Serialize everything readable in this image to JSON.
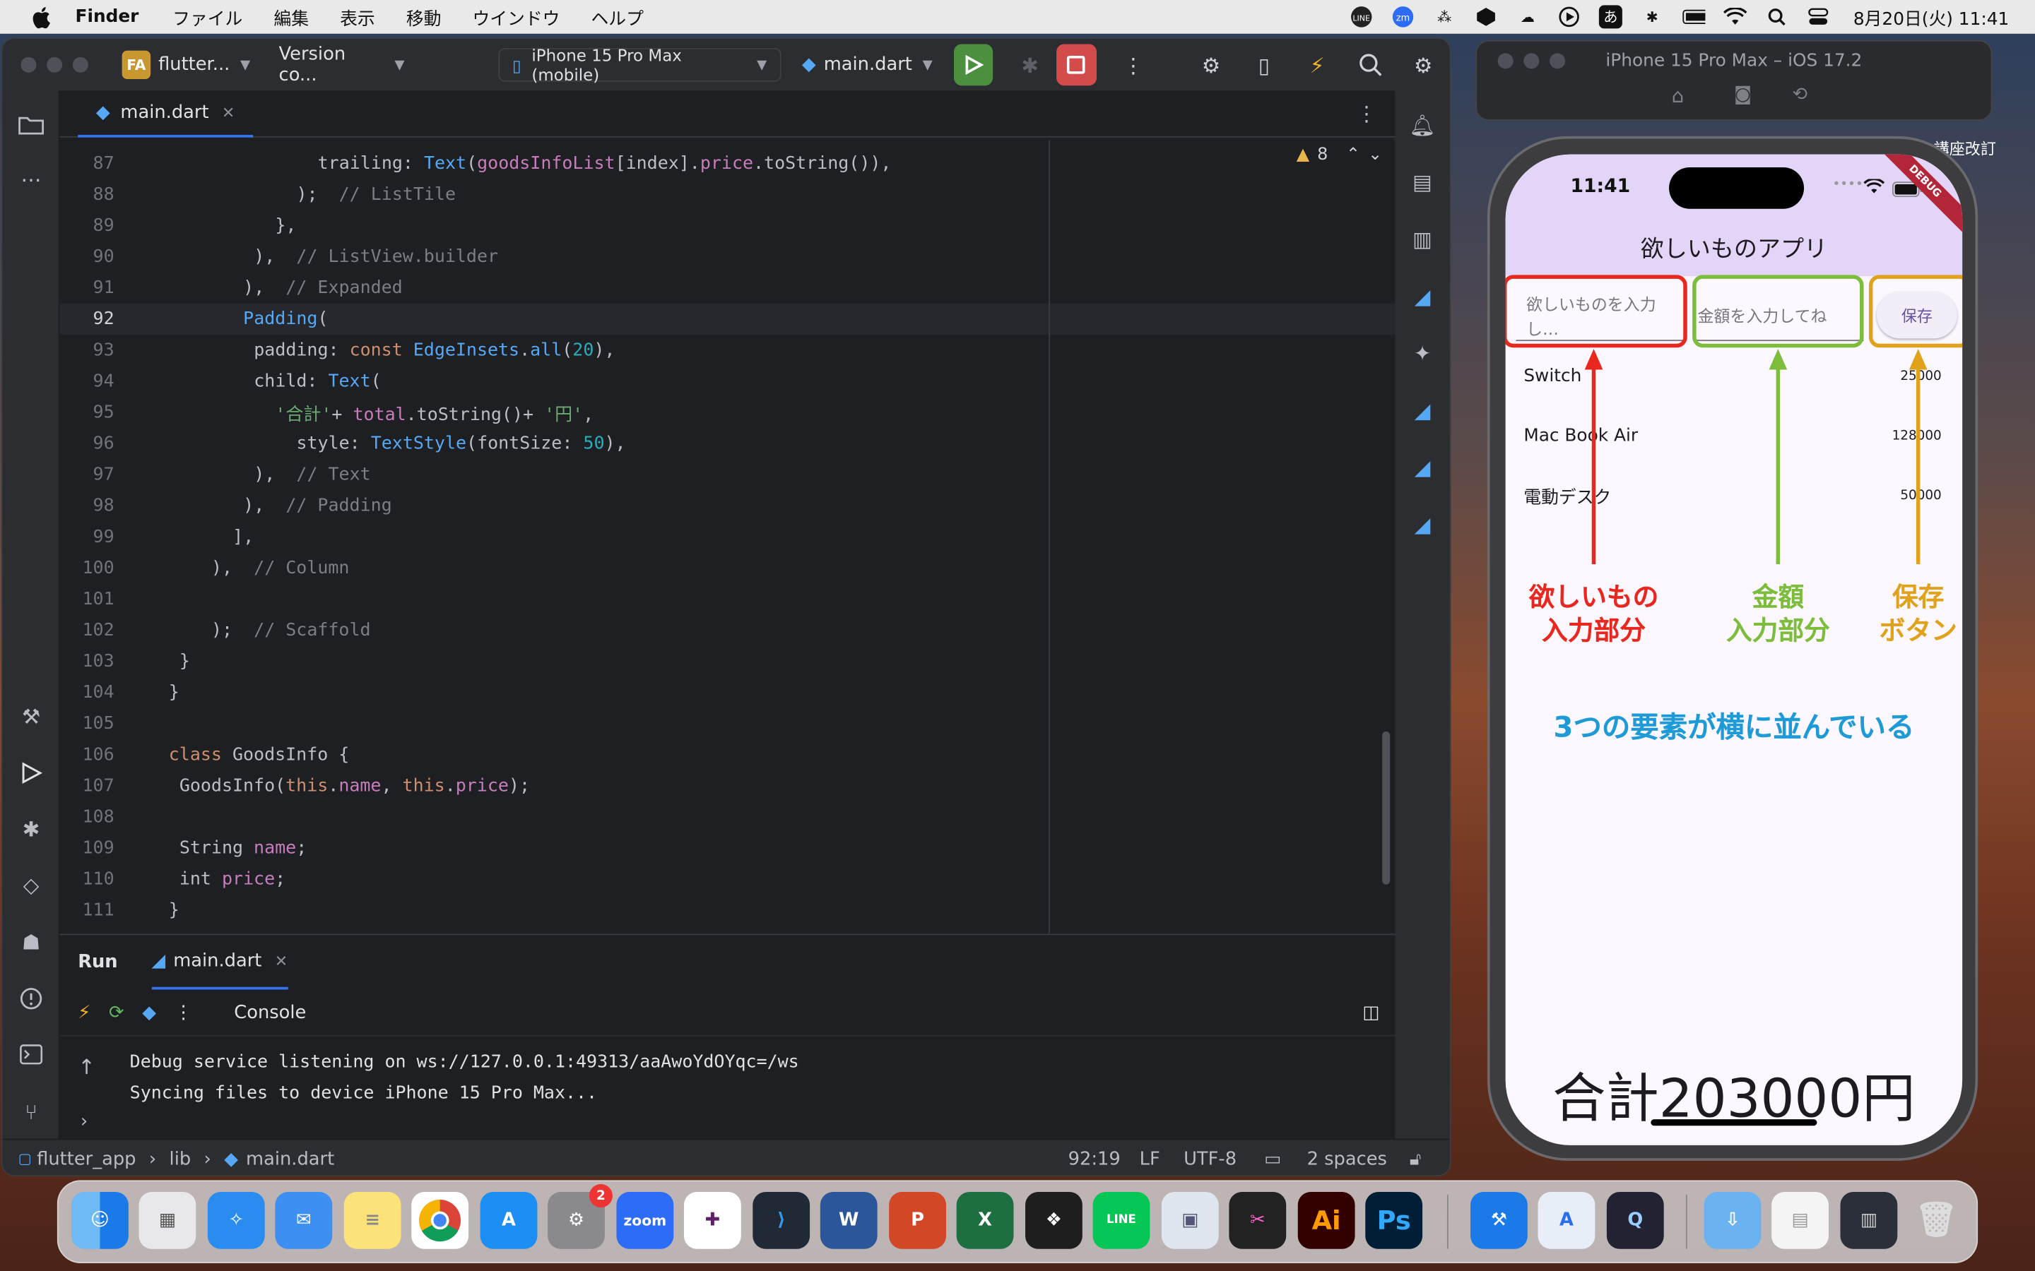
{
  "menubar": {
    "app": "Finder",
    "items": [
      "ファイル",
      "編集",
      "表示",
      "移動",
      "ウインドウ",
      "ヘルプ"
    ],
    "clock": "8月20日(火) 11:41",
    "ime": "あ"
  },
  "ide": {
    "project": "flutter...",
    "project_badge": "FA",
    "vcs": "Version co...",
    "device": "iPhone 15 Pro Max (mobile)",
    "config": "main.dart",
    "tab": "main.dart",
    "warnings": "8",
    "code_lines": [
      {
        "n": "87",
        "indent": 14,
        "segs": [
          [
            "trailing: ",
            "#bcbec4"
          ],
          [
            "Text",
            "#56a8f5"
          ],
          [
            "(",
            "#bcbec4"
          ],
          [
            "goodsInfoList",
            "#c77dbb"
          ],
          [
            "[index].",
            "#bcbec4"
          ],
          [
            "price",
            "#c77dbb"
          ],
          [
            ".toString()),",
            "#bcbec4"
          ]
        ]
      },
      {
        "n": "88",
        "indent": 12,
        "segs": [
          [
            ");  ",
            "#bcbec4"
          ],
          [
            "// ListTile",
            "#7a7e85"
          ]
        ]
      },
      {
        "n": "89",
        "indent": 10,
        "segs": [
          [
            "},",
            "#bcbec4"
          ]
        ]
      },
      {
        "n": "90",
        "indent": 8,
        "segs": [
          [
            "),  ",
            "#bcbec4"
          ],
          [
            "// ListView.builder",
            "#7a7e85"
          ]
        ]
      },
      {
        "n": "91",
        "indent": 7,
        "segs": [
          [
            "),  ",
            "#bcbec4"
          ],
          [
            "// Expanded",
            "#7a7e85"
          ]
        ]
      },
      {
        "n": "92",
        "indent": 7,
        "segs": [
          [
            "Padding",
            "#56a8f5"
          ],
          [
            "(",
            "#bcbec4"
          ]
        ]
      },
      {
        "n": "93",
        "indent": 8,
        "segs": [
          [
            "padding: ",
            "#bcbec4"
          ],
          [
            "const ",
            "#cf8e6d"
          ],
          [
            "EdgeInsets",
            "#56a8f5"
          ],
          [
            ".",
            "#bcbec4"
          ],
          [
            "all",
            "#56a8f5"
          ],
          [
            "(",
            "#bcbec4"
          ],
          [
            "20",
            "#2aacb8"
          ],
          [
            "),",
            "#bcbec4"
          ]
        ]
      },
      {
        "n": "94",
        "indent": 8,
        "segs": [
          [
            "child: ",
            "#bcbec4"
          ],
          [
            "Text",
            "#56a8f5"
          ],
          [
            "(",
            "#bcbec4"
          ]
        ]
      },
      {
        "n": "95",
        "indent": 10,
        "segs": [
          [
            "'合計'",
            "#6aab73"
          ],
          [
            "+ ",
            "#bcbec4"
          ],
          [
            "total",
            "#c77dbb"
          ],
          [
            ".toString()+ ",
            "#bcbec4"
          ],
          [
            "'円'",
            "#6aab73"
          ],
          [
            ",",
            "#bcbec4"
          ]
        ]
      },
      {
        "n": "96",
        "indent": 12,
        "segs": [
          [
            "style: ",
            "#bcbec4"
          ],
          [
            "TextStyle",
            "#56a8f5"
          ],
          [
            "(",
            "#bcbec4"
          ],
          [
            "fontSize: ",
            "#bcbec4"
          ],
          [
            "50",
            "#2aacb8"
          ],
          [
            "),",
            "#bcbec4"
          ]
        ]
      },
      {
        "n": "97",
        "indent": 8,
        "segs": [
          [
            "),  ",
            "#bcbec4"
          ],
          [
            "// Text",
            "#7a7e85"
          ]
        ]
      },
      {
        "n": "98",
        "indent": 7,
        "segs": [
          [
            "),  ",
            "#bcbec4"
          ],
          [
            "// Padding",
            "#7a7e85"
          ]
        ]
      },
      {
        "n": "99",
        "indent": 6,
        "segs": [
          [
            "],",
            "#bcbec4"
          ]
        ]
      },
      {
        "n": "100",
        "indent": 4,
        "segs": [
          [
            "),  ",
            "#bcbec4"
          ],
          [
            "// Column",
            "#7a7e85"
          ]
        ]
      },
      {
        "n": "101",
        "indent": 0,
        "segs": []
      },
      {
        "n": "102",
        "indent": 4,
        "segs": [
          [
            ");  ",
            "#bcbec4"
          ],
          [
            "// Scaffold",
            "#7a7e85"
          ]
        ]
      },
      {
        "n": "103",
        "indent": 1,
        "segs": [
          [
            "}",
            "#bcbec4"
          ]
        ]
      },
      {
        "n": "104",
        "indent": 0,
        "segs": [
          [
            "}",
            "#bcbec4"
          ]
        ]
      },
      {
        "n": "105",
        "indent": 0,
        "segs": []
      },
      {
        "n": "106",
        "indent": 0,
        "segs": [
          [
            "class ",
            "#cf8e6d"
          ],
          [
            "GoodsInfo {",
            "#bcbec4"
          ]
        ]
      },
      {
        "n": "107",
        "indent": 1,
        "segs": [
          [
            "GoodsInfo(",
            "#bcbec4"
          ],
          [
            "this",
            "#cf8e6d"
          ],
          [
            ".",
            "#bcbec4"
          ],
          [
            "name",
            "#c77dbb"
          ],
          [
            ", ",
            "#bcbec4"
          ],
          [
            "this",
            "#cf8e6d"
          ],
          [
            ".",
            "#bcbec4"
          ],
          [
            "price",
            "#c77dbb"
          ],
          [
            ");",
            "#bcbec4"
          ]
        ]
      },
      {
        "n": "108",
        "indent": 0,
        "segs": []
      },
      {
        "n": "109",
        "indent": 1,
        "segs": [
          [
            "String ",
            "#bcbec4"
          ],
          [
            "name",
            "#c77dbb"
          ],
          [
            ";",
            "#bcbec4"
          ]
        ]
      },
      {
        "n": "110",
        "indent": 1,
        "segs": [
          [
            "int ",
            "#bcbec4"
          ],
          [
            "price",
            "#c77dbb"
          ],
          [
            ";",
            "#bcbec4"
          ]
        ]
      },
      {
        "n": "111",
        "indent": 0,
        "segs": [
          [
            "}",
            "#bcbec4"
          ]
        ]
      }
    ],
    "current_line": "92",
    "run": {
      "tab_run": "Run",
      "tab_file": "main.dart",
      "console_label": "Console",
      "lines": [
        "Debug service listening on ws://127.0.0.1:49313/aaAwoYdOYqc=/ws",
        "Syncing files to device iPhone 15 Pro Max..."
      ]
    },
    "status": {
      "crumbs": [
        "flutter_app",
        "lib",
        "main.dart"
      ],
      "position": "92:19",
      "line_sep": "LF",
      "encoding": "UTF-8",
      "indent": "2 spaces"
    }
  },
  "simulator": {
    "title": "iPhone 15 Pro Max – iOS 17.2",
    "side_text": "講座改訂",
    "time": "11:41",
    "debug_banner": "DEBUG",
    "app_title": "欲しいものアプリ",
    "name_placeholder": "欲しいものを入力し…",
    "price_placeholder": "金額を入力してね",
    "save_label": "保存",
    "items": [
      {
        "name": "Switch",
        "price": "25000"
      },
      {
        "name": "Mac Book Air",
        "price": "128000"
      },
      {
        "name": "電動デスク",
        "price": "50000"
      }
    ],
    "total": "合計203000円",
    "annotations": {
      "name_label_1": "欲しいもの",
      "name_label_2": "入力部分",
      "price_label_1": "金額",
      "price_label_2": "入力部分",
      "save_label_1": "保存",
      "save_label_2": "ボタン",
      "summary": "3つの要素が横に並んでいる"
    },
    "colors": {
      "red": "#e8281e",
      "green": "#7cbd3c",
      "yellow": "#e0a21a",
      "blue": "#1e9bd7"
    }
  },
  "dock": {
    "items": [
      "finder-icon",
      "launchpad-icon",
      "safari-icon",
      "mail-icon",
      "notes-icon",
      "chrome-icon",
      "app-store-icon",
      "system-settings-icon",
      "zoom-icon",
      "slack-icon",
      "vscode-icon",
      "word-icon",
      "powerpoint-icon",
      "excel-icon",
      "figma-icon",
      "line-icon",
      "preview-icon",
      "final-cut-icon",
      "illustrator-icon",
      "photoshop-icon",
      "xcode-icon",
      "instruments-icon",
      "quicktime-icon",
      "downloads-icon",
      "recent-doc-icon",
      "recent-doc2-icon",
      "trash-icon"
    ],
    "zoom_label": "zoom",
    "settings_badge": "2",
    "ai_label": "Ai",
    "ps_label": "Ps"
  }
}
